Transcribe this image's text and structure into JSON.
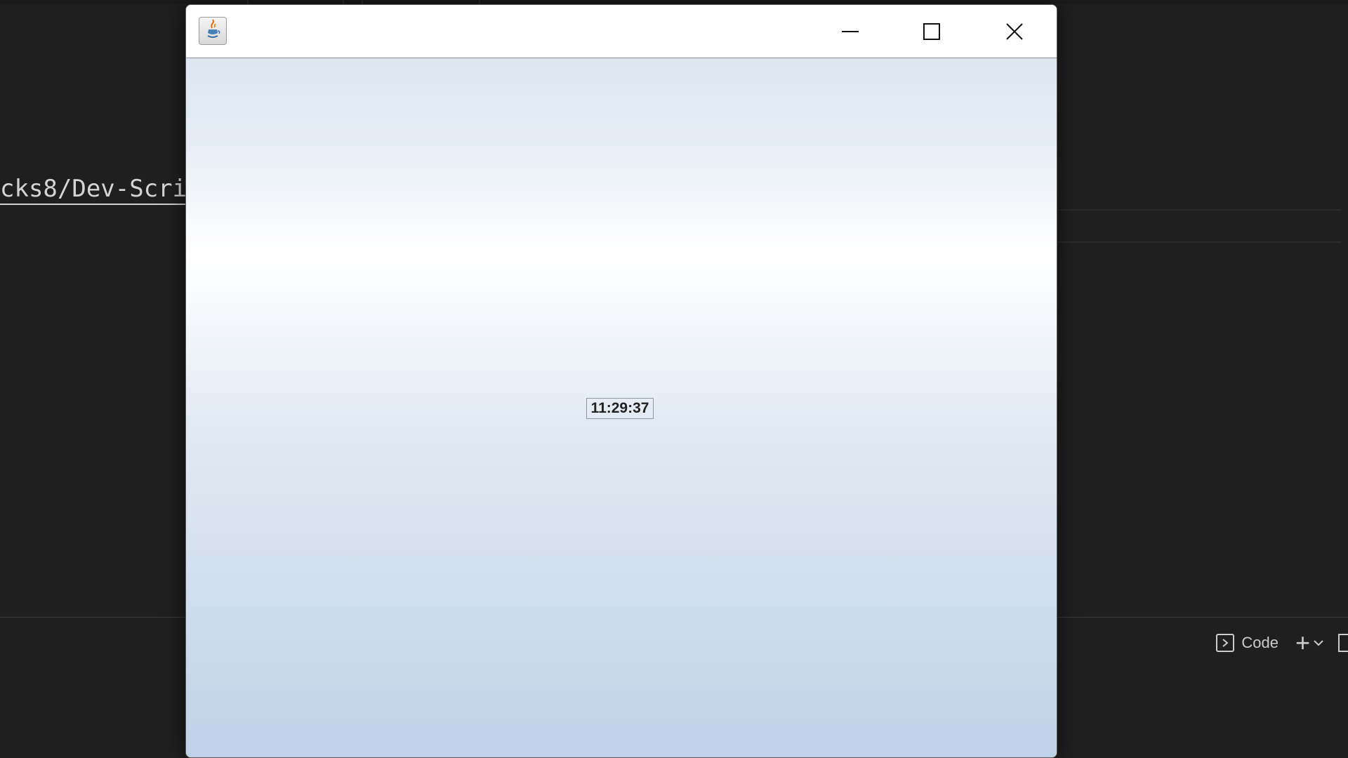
{
  "background_editor": {
    "link_text": "cks8/Dev-Scri",
    "terminal": {
      "profile_label": "Code",
      "icons": [
        "terminal-icon",
        "plus-icon",
        "chevron-down-icon",
        "split-icon"
      ]
    }
  },
  "java_window": {
    "title": "",
    "app_icon": "java-icon",
    "controls": {
      "minimize": "minimize-icon",
      "maximize": "maximize-icon",
      "close": "close-icon"
    },
    "clock_time": "11:29:37"
  },
  "colors": {
    "editor_background": "#1f1f1f",
    "gradient_top": "#dde6f1",
    "gradient_light": "#ffffff",
    "gradient_bottom": "#bdd2e8"
  }
}
